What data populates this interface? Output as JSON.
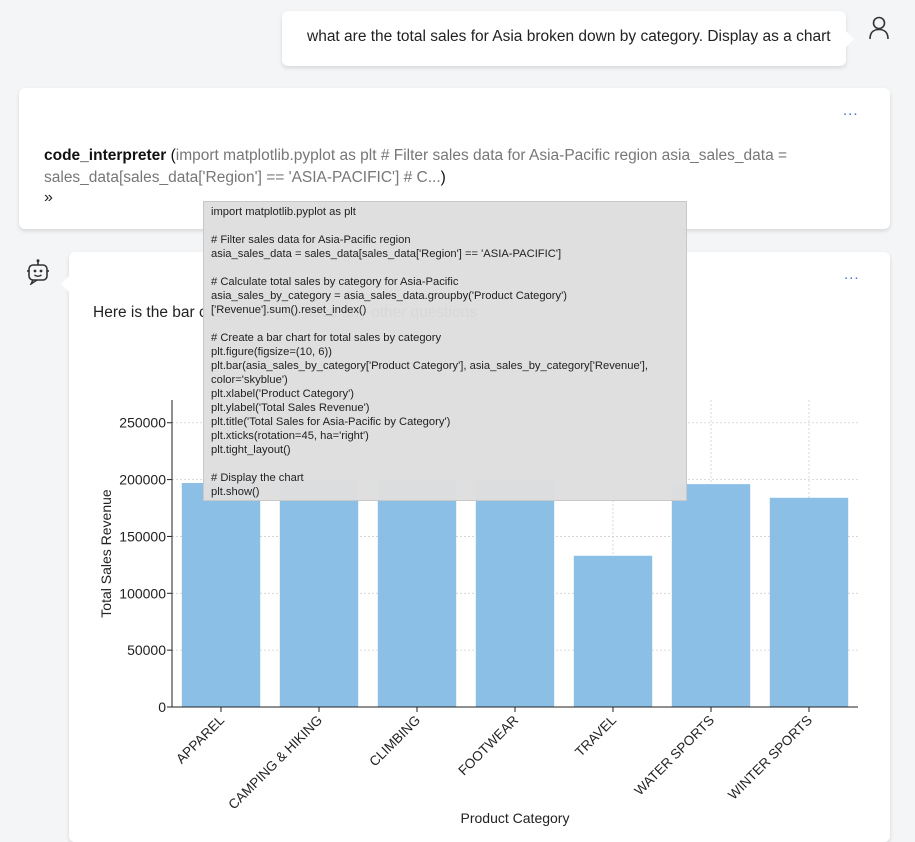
{
  "user_message": "what are the total sales for Asia broken down by category. Display as a chart",
  "tool_call": {
    "more_label": "...",
    "name": "code_interpreter",
    "open_paren": " (",
    "args_preview": "import matplotlib.pyplot as plt # Filter sales data for Asia-Pacific region asia_sales_data = sales_data[sales_data['Region'] == 'ASIA-PACIFIC'] # C...",
    "close_paren": ")",
    "expand_label": "»"
  },
  "tooltip_code": "import matplotlib.pyplot as plt\n\n# Filter sales data for Asia-Pacific region\nasia_sales_data = sales_data[sales_data['Region'] == 'ASIA-PACIFIC']\n\n# Calculate total sales by category for Asia-Pacific\nasia_sales_by_category = asia_sales_data.groupby('Product Category')\n['Revenue'].sum().reset_index()\n\n# Create a bar chart for total sales by category\nplt.figure(figsize=(10, 6))\nplt.bar(asia_sales_by_category['Product Category'], asia_sales_by_category['Revenue'],\ncolor='skyblue')\nplt.xlabel('Product Category')\nplt.ylabel('Total Sales Revenue')\nplt.title('Total Sales for Asia-Pacific by Category')\nplt.xticks(rotation=45, ha='right')\nplt.tight_layout()\n\n# Display the chart\nplt.show()",
  "assistant": {
    "more_label": "...",
    "text_visible": "Here is the bar c                                                                                                 tegory. If you have any other questions"
  },
  "colors": {
    "bar": "#8bbfe6",
    "link": "#4a6fd1",
    "grid": "#d0d0d0"
  },
  "chart_data": {
    "type": "bar",
    "categories": [
      "APPAREL",
      "CAMPING & HIKING",
      "CLIMBING",
      "FOOTWEAR",
      "TRAVEL",
      "WATER SPORTS",
      "WINTER SPORTS"
    ],
    "values": [
      197000,
      200000,
      200000,
      200000,
      133000,
      196000,
      184000
    ],
    "xlabel": "Product Category",
    "ylabel": "Total Sales Revenue",
    "ylim": [
      0,
      270000
    ],
    "yticks": [
      0,
      50000,
      100000,
      150000,
      200000,
      250000
    ],
    "grid": true,
    "bar_color": "skyblue"
  }
}
